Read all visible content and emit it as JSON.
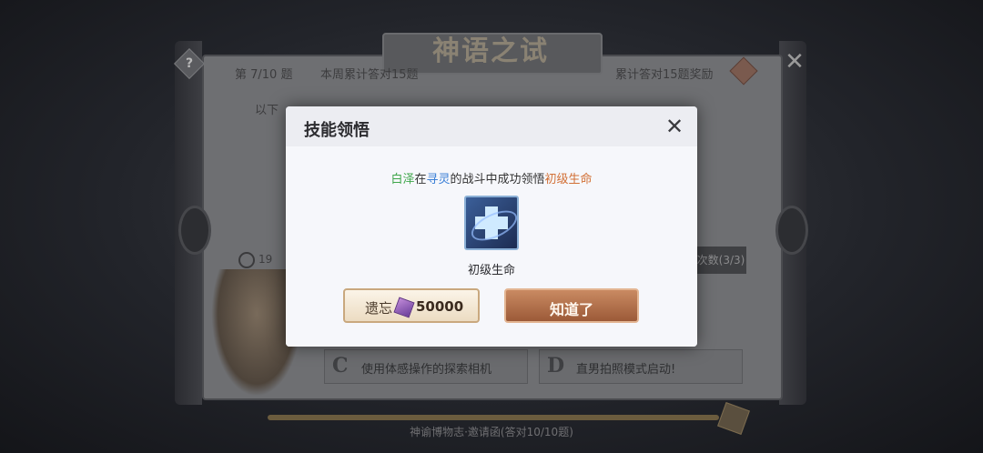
{
  "background": {
    "title": "神语之试",
    "progress": "第 7/10 题",
    "week_total": "本周累计答对15题",
    "reward_label": "累计答对15题奖励",
    "question_text": "以下",
    "timer": "19",
    "count_badge": "次数(3/3)",
    "option_c_letter": "C",
    "option_c_text": "使用体感操作的探索相机",
    "option_d_letter": "D",
    "option_d_text": "直男拍照模式启动!",
    "bottom_text": "神谕博物志·邀请函(答对10/10题)"
  },
  "modal": {
    "title": "技能领悟",
    "learn_line": {
      "character": "白泽",
      "connector1": "在",
      "location": "寻灵",
      "connector2": "的战斗中成功领悟",
      "skill": "初级生命"
    },
    "skill_name": "初级生命",
    "forget_label": "遗忘",
    "forget_cost": "50000",
    "ok_label": "知道了"
  },
  "colors": {
    "character": "#3ea64a",
    "location": "#3a7fd6",
    "skill": "#d27036",
    "ok_button": "#b06e48"
  },
  "icons": {
    "close": "close-icon",
    "skill": "heal-cross-icon",
    "currency": "gem-icon"
  }
}
